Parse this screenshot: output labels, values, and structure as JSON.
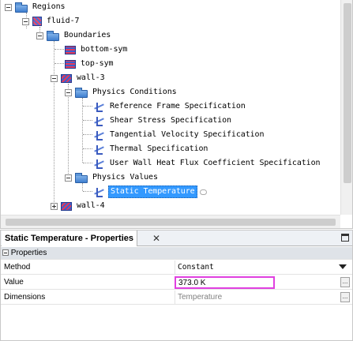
{
  "tree": {
    "items": [
      {
        "label": "Regions"
      },
      {
        "label": "fluid-7"
      },
      {
        "label": "Boundaries"
      },
      {
        "label": "bottom-sym"
      },
      {
        "label": "top-sym"
      },
      {
        "label": "wall-3"
      },
      {
        "label": "Physics Conditions"
      },
      {
        "label": "Reference Frame Specification"
      },
      {
        "label": "Shear Stress Specification"
      },
      {
        "label": "Tangential Velocity Specification"
      },
      {
        "label": "Thermal Specification"
      },
      {
        "label": "User Wall Heat Flux Coefficient Specification"
      },
      {
        "label": "Physics Values"
      },
      {
        "label": "Static Temperature"
      },
      {
        "label": "wall-4"
      }
    ],
    "selected": "Static Temperature"
  },
  "properties": {
    "tab_title": "Static Temperature - Properties",
    "close_glyph": "✕",
    "category": "Properties",
    "rows": {
      "method": {
        "name": "Method",
        "value": "Constant"
      },
      "value": {
        "name": "Value",
        "value": "373.0 K"
      },
      "dimensions": {
        "name": "Dimensions",
        "value": "Temperature"
      }
    },
    "ellipsis": "..."
  },
  "colors": {
    "selection": "#3399ff",
    "value_highlight": "#e040e0",
    "category_bg": "#dfe3e8"
  }
}
